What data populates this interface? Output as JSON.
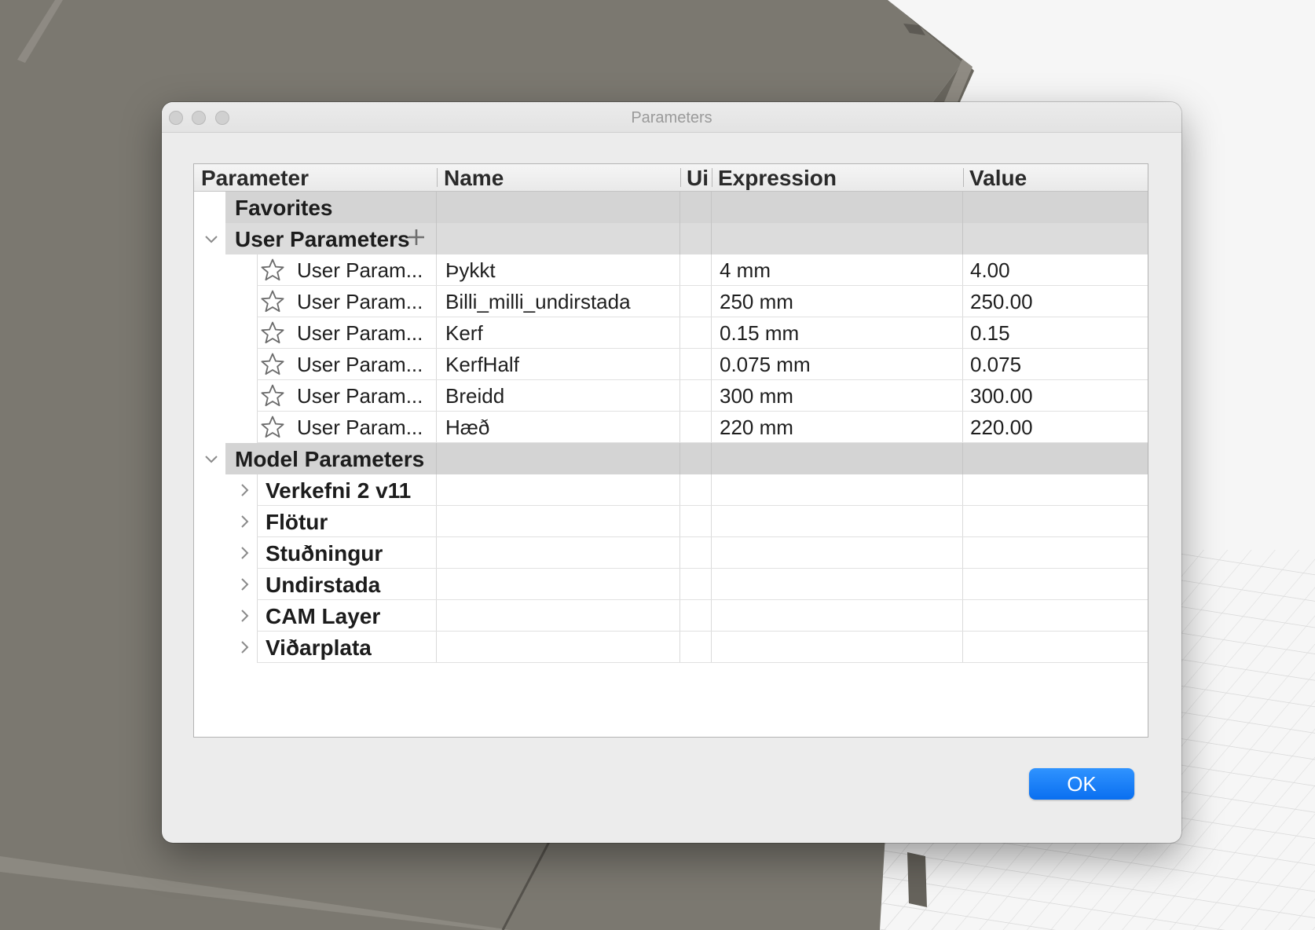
{
  "window": {
    "title": "Parameters"
  },
  "table": {
    "columns": [
      "Parameter",
      "Name",
      "Ui",
      "Expression",
      "Value"
    ],
    "groups": {
      "favorites": "Favorites",
      "user": "User Parameters",
      "model": "Model Parameters"
    },
    "user_params": [
      {
        "param": "User Param...",
        "name": "Þykkt",
        "unit": "",
        "expression": "4 mm",
        "value": "4.00"
      },
      {
        "param": "User Param...",
        "name": "Billi_milli_undirstada",
        "unit": "",
        "expression": "250 mm",
        "value": "250.00"
      },
      {
        "param": "User Param...",
        "name": "Kerf",
        "unit": "",
        "expression": "0.15 mm",
        "value": "0.15"
      },
      {
        "param": "User Param...",
        "name": "KerfHalf",
        "unit": "",
        "expression": "0.075 mm",
        "value": "0.075"
      },
      {
        "param": "User Param...",
        "name": "Breidd",
        "unit": "",
        "expression": "300 mm",
        "value": "300.00"
      },
      {
        "param": "User Param...",
        "name": "Hæð",
        "unit": "",
        "expression": "220 mm",
        "value": "220.00"
      }
    ],
    "model_params": [
      "Verkefni 2 v11",
      "Flötur",
      "Stuðningur",
      "Undirstada",
      "CAM Layer",
      "Viðarplata"
    ]
  },
  "buttons": {
    "ok": "OK"
  },
  "icons": {
    "add": "plus-icon",
    "favorite": "star-outline-icon",
    "expanded": "chevron-down-icon",
    "collapsed": "chevron-right-icon"
  },
  "colors": {
    "accent": "#0a6ff0",
    "header_band": "#d4d4d4"
  }
}
